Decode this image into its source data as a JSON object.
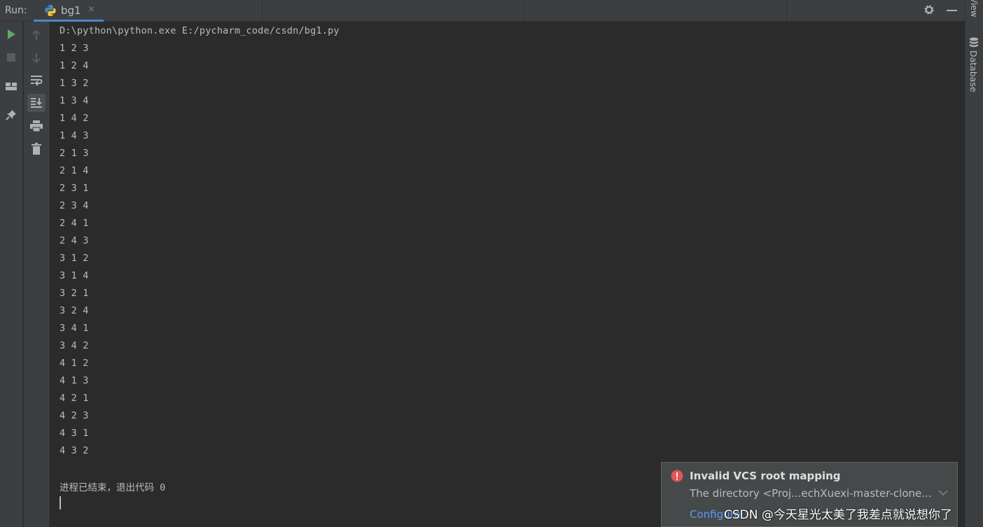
{
  "toolbar": {
    "run_label": "Run:",
    "tab_title": "bg1",
    "tab_close": "×"
  },
  "right_strip": {
    "top_label": "View",
    "database_label": "Database"
  },
  "console": {
    "command": "D:\\python\\python.exe E:/pycharm_code/csdn/bg1.py",
    "lines": [
      "1 2 3",
      "1 2 4",
      "1 3 2",
      "1 3 4",
      "1 4 2",
      "1 4 3",
      "2 1 3",
      "2 1 4",
      "2 3 1",
      "2 3 4",
      "2 4 1",
      "2 4 3",
      "3 1 2",
      "3 1 4",
      "3 2 1",
      "3 2 4",
      "3 4 1",
      "3 4 2",
      "4 1 2",
      "4 1 3",
      "4 2 1",
      "4 2 3",
      "4 3 1",
      "4 3 2"
    ],
    "exit_message": "进程已结束，退出代码 0"
  },
  "notification": {
    "title": "Invalid VCS root mapping",
    "body": "The directory <Proj...echXuexi-master-clone...",
    "link": "Configure"
  },
  "watermark": "CSDN @今天星光太美了我差点就说想你了",
  "colors": {
    "background": "#2b2b2b",
    "panel": "#3c3f41",
    "text": "#bbbbbb",
    "run_green": "#59a869",
    "tab_accent": "#4a88c7",
    "error_red": "#e05555",
    "link_blue": "#589df6"
  },
  "icons": {
    "tab": "python-icon",
    "settings": "gear-icon",
    "rerun": "play-icon",
    "stop": "stop-icon",
    "layout": "layout-icon",
    "pin": "pin-icon",
    "up": "arrow-up-icon",
    "down": "arrow-down-icon",
    "soft_wrap": "soft-wrap-icon",
    "scroll_to_end": "scroll-to-end-icon",
    "print": "print-icon",
    "clear": "trash-icon",
    "database": "database-icon",
    "error": "error-icon"
  }
}
